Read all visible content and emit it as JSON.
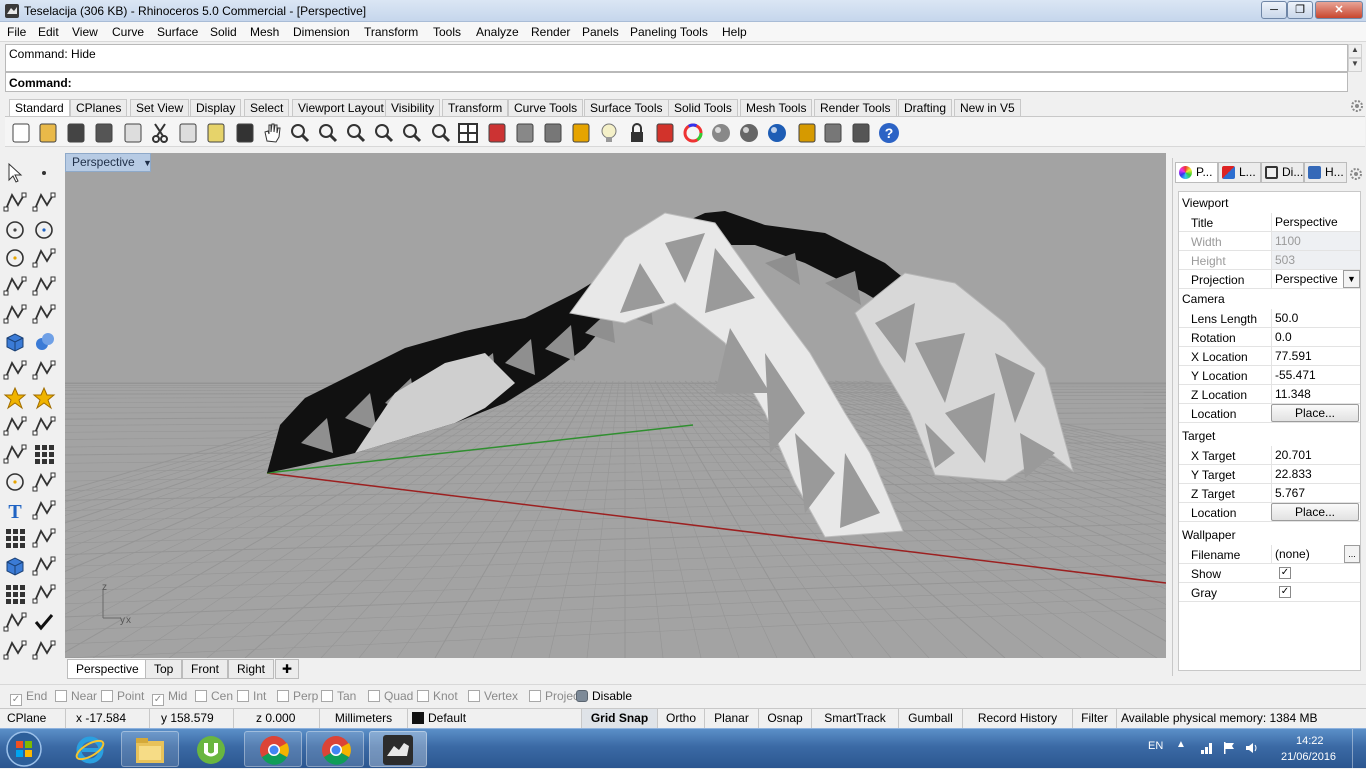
{
  "window": {
    "title": "Teselacija (306 KB) - Rhinoceros 5.0 Commercial - [Perspective]"
  },
  "menu": [
    "File",
    "Edit",
    "View",
    "Curve",
    "Surface",
    "Solid",
    "Mesh",
    "Dimension",
    "Transform",
    "Tools",
    "Analyze",
    "Render",
    "Panels",
    "Paneling Tools",
    "Help"
  ],
  "command": {
    "history": "Command: Hide",
    "prompt": "Command:"
  },
  "toolbar_tabs": [
    "Standard",
    "CPlanes",
    "Set View",
    "Display",
    "Select",
    "Viewport Layout",
    "Visibility",
    "Transform",
    "Curve Tools",
    "Surface Tools",
    "Solid Tools",
    "Mesh Tools",
    "Render Tools",
    "Drafting",
    "New in V5"
  ],
  "toolbar_icons": [
    "new-icon",
    "open-icon",
    "save-icon",
    "print-icon",
    "import-icon",
    "cut-icon",
    "copy-icon",
    "paste-icon",
    "undo-icon",
    "pan-icon",
    "rotate-view-icon",
    "zoom-dynamic-icon",
    "zoom-window-icon",
    "zoom-extents-icon",
    "zoom-selected-icon",
    "undo-view-icon",
    "four-viewports-icon",
    "car-options-icon",
    "viewport-properties-icon",
    "cplane-icon",
    "object-snap-icon",
    "light-bulb-icon",
    "lock-icon",
    "layer-icon",
    "color-wheel-icon",
    "render-preview-icon",
    "ghosted-icon",
    "rendered-sphere-icon",
    "paneling-icon",
    "settings-icon",
    "history-icon",
    "help-icon"
  ],
  "viewport": {
    "name": "Perspective",
    "axis_z": "z",
    "axis_y": "y",
    "axis_x": "x"
  },
  "viewport_tabs": [
    "Perspective",
    "Top",
    "Front",
    "Right"
  ],
  "panel": {
    "tabs": [
      "P...",
      "L...",
      "Di...",
      "H..."
    ],
    "viewport_section": "Viewport",
    "title_label": "Title",
    "title_value": "Perspective",
    "width_label": "Width",
    "width_value": "1100",
    "height_label": "Height",
    "height_value": "503",
    "projection_label": "Projection",
    "projection_value": "Perspective",
    "camera_section": "Camera",
    "lens_label": "Lens Length",
    "lens_value": "50.0",
    "rotation_label": "Rotation",
    "rotation_value": "0.0",
    "xloc_label": "X Location",
    "xloc_value": "77.591",
    "yloc_label": "Y Location",
    "yloc_value": "-55.471",
    "zloc_label": "Z Location",
    "zloc_value": "11.348",
    "loc_label": "Location",
    "place_button": "Place...",
    "target_section": "Target",
    "xt_label": "X Target",
    "xt_value": "20.701",
    "yt_label": "Y Target",
    "yt_value": "22.833",
    "zt_label": "Z Target",
    "zt_value": "5.767",
    "tloc_label": "Location",
    "tplace_button": "Place...",
    "wallpaper_section": "Wallpaper",
    "filename_label": "Filename",
    "filename_value": "(none)",
    "browse_button": "...",
    "show_label": "Show",
    "show_checked": true,
    "gray_label": "Gray",
    "gray_checked": true
  },
  "osnaps": [
    {
      "label": "End",
      "checked": true
    },
    {
      "label": "Near",
      "checked": false
    },
    {
      "label": "Point",
      "checked": false
    },
    {
      "label": "Mid",
      "checked": true
    },
    {
      "label": "Cen",
      "checked": false
    },
    {
      "label": "Int",
      "checked": false
    },
    {
      "label": "Perp",
      "checked": false
    },
    {
      "label": "Tan",
      "checked": false
    },
    {
      "label": "Quad",
      "checked": false
    },
    {
      "label": "Knot",
      "checked": false
    },
    {
      "label": "Vertex",
      "checked": false
    },
    {
      "label": "Project",
      "checked": false
    },
    {
      "label": "Disable",
      "checked": false
    }
  ],
  "status": {
    "cplane": "CPlane",
    "x": "x -17.584",
    "y": "y 158.579",
    "z": "z 0.000",
    "units": "Millimeters",
    "layer": "Default",
    "grid_snap": "Grid Snap",
    "ortho": "Ortho",
    "planar": "Planar",
    "osnap": "Osnap",
    "smarttrack": "SmartTrack",
    "gumball": "Gumball",
    "record_history": "Record History",
    "filter": "Filter",
    "memory": "Available physical memory: 1384 MB"
  },
  "taskbar": {
    "language": "EN",
    "time": "14:22",
    "date": "21/06/2016",
    "apps": [
      "internet-explorer-icon",
      "file-explorer-icon",
      "utorrent-icon",
      "chrome-icon",
      "chrome-icon",
      "rhinoceros-icon"
    ]
  }
}
